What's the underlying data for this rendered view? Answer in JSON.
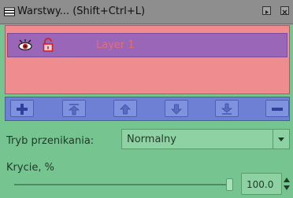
{
  "window": {
    "title": "Warstwy... (Shift+Ctrl+L)",
    "icon": "layers-dialog-icon",
    "buttons": [
      "minimize-icon",
      "close-icon"
    ]
  },
  "layers": [
    {
      "name": "Layer 1",
      "visible": true,
      "locked": true,
      "selected": true
    }
  ],
  "toolbar": {
    "buttons": [
      {
        "name": "add-layer-button",
        "icon": "plus-icon"
      },
      {
        "name": "move-layer-top-button",
        "icon": "raise-to-top-icon"
      },
      {
        "name": "raise-layer-button",
        "icon": "arrow-up-icon"
      },
      {
        "name": "lower-layer-button",
        "icon": "arrow-down-icon"
      },
      {
        "name": "move-layer-bottom-button",
        "icon": "lower-to-bottom-icon"
      },
      {
        "name": "delete-layer-button",
        "icon": "minus-icon"
      }
    ]
  },
  "blend": {
    "label": "Tryb przenikania:",
    "value": "Normalny"
  },
  "opacity": {
    "label": "Krycie, %",
    "value": "100.0",
    "percent": 100
  },
  "colors": {
    "titlebar": "#8e8e8e",
    "layers_panel": "#ee8c90",
    "selected_layer": "#9a66b8",
    "layer_text": "#e36e78",
    "toolbar": "#6e80d4",
    "panel": "#76c48f"
  }
}
